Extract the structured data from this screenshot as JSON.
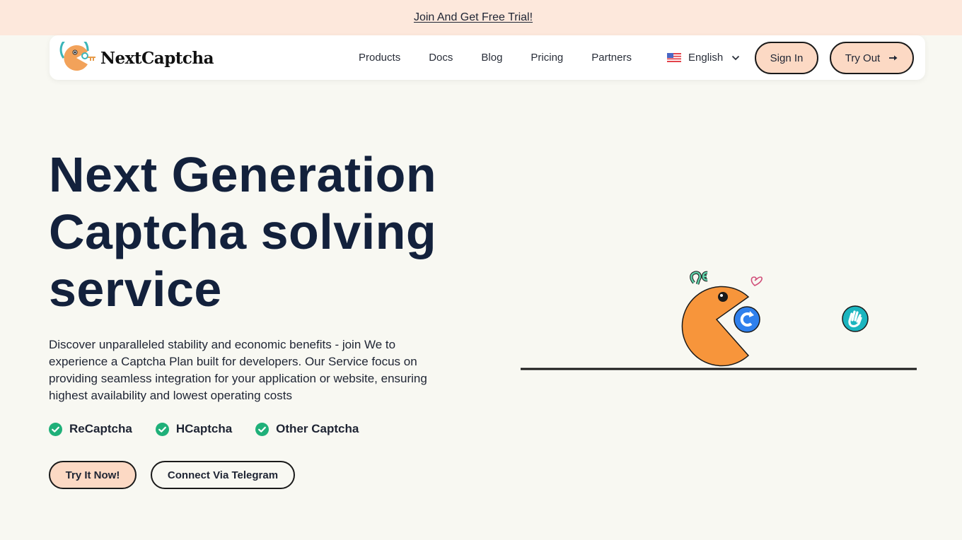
{
  "promo": {
    "text": "Join And Get Free Trial!"
  },
  "header": {
    "logo_text": "NextCaptcha",
    "nav": [
      {
        "label": "Products"
      },
      {
        "label": "Docs"
      },
      {
        "label": "Blog"
      },
      {
        "label": "Pricing"
      },
      {
        "label": "Partners"
      }
    ],
    "language": {
      "selected": "English",
      "flag_icon": "us-flag-icon"
    },
    "sign_in_label": "Sign In",
    "try_out_label": "Try Out"
  },
  "hero": {
    "title_lines": [
      "Next Generation",
      "Captcha solving",
      "service"
    ],
    "description": "Discover unparalleled stability and economic benefits - join We to experience a Captcha Plan built for developers. Our Service focus on providing seamless integration for your application or website, ensuring highest availability and lowest operating costs",
    "features": [
      {
        "label": "ReCaptcha"
      },
      {
        "label": "HCaptcha"
      },
      {
        "label": "Other Captcha"
      }
    ],
    "primary_cta": "Try It Now!",
    "secondary_cta": "Connect Via Telegram"
  },
  "colors": {
    "background": "#f8f8f2",
    "promo_bg": "#fde8dc",
    "accent_button": "#fcd9c4",
    "heading": "#13213c",
    "check_green": "#1fb079",
    "pacman_orange": "#f7953b",
    "recaptcha_blue": "#2f80ed",
    "hand_teal": "#1bb5bf"
  }
}
